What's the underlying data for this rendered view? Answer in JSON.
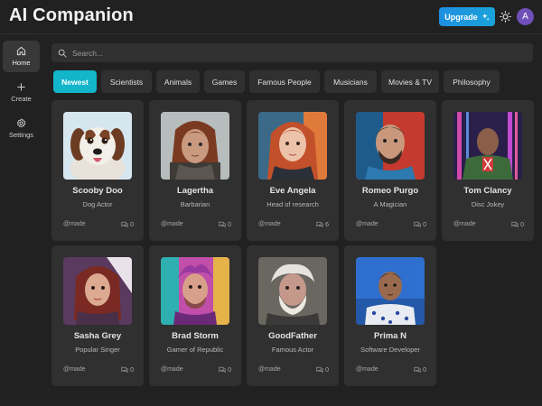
{
  "app": {
    "title": "AI Companion"
  },
  "header": {
    "upgrade_label": "Upgrade",
    "upgrade_icon": "sparkles-icon",
    "theme_icon": "sun-icon",
    "avatar_initial": "A"
  },
  "sidebar": {
    "items": [
      {
        "label": "Home",
        "icon": "home-icon",
        "active": true
      },
      {
        "label": "Create",
        "icon": "plus-icon",
        "active": false
      },
      {
        "label": "Settings",
        "icon": "gear-icon",
        "active": false
      }
    ]
  },
  "search": {
    "placeholder": "Search...",
    "value": ""
  },
  "categories": {
    "items": [
      {
        "label": "Newest",
        "active": true
      },
      {
        "label": "Scientists"
      },
      {
        "label": "Animals"
      },
      {
        "label": "Games"
      },
      {
        "label": "Famous People"
      },
      {
        "label": "Musicians"
      },
      {
        "label": "Movies & TV"
      },
      {
        "label": "Philosophy"
      }
    ]
  },
  "companions": [
    {
      "name": "Scooby Doo",
      "description": "Dog Actor",
      "author": "@made",
      "messages": "0"
    },
    {
      "name": "Lagertha",
      "description": "Barbarian",
      "author": "@made",
      "messages": "0"
    },
    {
      "name": "Eve Angela",
      "description": "Head of research",
      "author": "@made",
      "messages": "6"
    },
    {
      "name": "Romeo Purgo",
      "description": "A Magician",
      "author": "@made",
      "messages": "0"
    },
    {
      "name": "Tom Clancy",
      "description": "Disc Jokey",
      "author": "@made",
      "messages": "0"
    },
    {
      "name": "Sasha Grey",
      "description": "Popular Singer",
      "author": "@made",
      "messages": "0"
    },
    {
      "name": "Brad Storm",
      "description": "Gamer of Republic",
      "author": "@made",
      "messages": "0"
    },
    {
      "name": "GoodFather",
      "description": "Famous Actor",
      "author": "@made",
      "messages": "0"
    },
    {
      "name": "Prima N",
      "description": "Software Developer",
      "author": "@made",
      "messages": "0"
    }
  ],
  "colors": {
    "background": "#212121",
    "surface": "#303030",
    "accent": "#12b5c9",
    "upgrade": "#1f8fe0",
    "avatar": "#6f50b8"
  }
}
